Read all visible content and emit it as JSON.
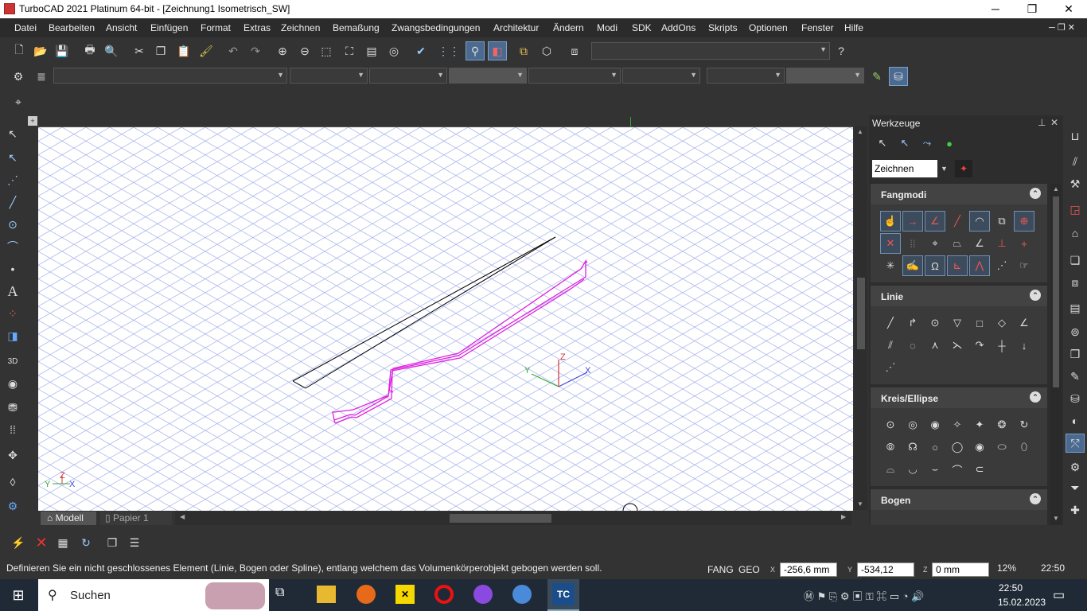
{
  "window": {
    "title": "TurboCAD 2021 Platinum 64-bit - [Zeichnung1 Isometrisch_SW]",
    "minimize": "─",
    "maximize": "❐",
    "close": "✕"
  },
  "menu": [
    "Datei",
    "Bearbeiten",
    "Ansicht",
    "Einfügen",
    "Format",
    "Extras",
    "Zeichnen",
    "Bemaßung",
    "Zwangsbedingungen",
    "Architektur",
    "Ändern",
    "Modi",
    "SDK",
    "AddOns",
    "Skripts",
    "Optionen",
    "Fenster",
    "Hilfe"
  ],
  "panel": {
    "title": "Werkzeuge",
    "palette_select": "Zeichnen",
    "sections": [
      {
        "label": "Fangmodi",
        "rows": 3
      },
      {
        "label": "Linie",
        "rows": 3
      },
      {
        "label": "Kreis/Ellipse",
        "rows": 3
      },
      {
        "label": "Bogen",
        "rows": 0
      }
    ]
  },
  "tabs": {
    "model": "Modell",
    "paper": "Papier 1"
  },
  "status": {
    "message": "Definieren Sie ein nicht geschlossenes Element (Linie, Bogen oder Spline), entlang welchem das Volumenkörperobjekt gebogen werden soll.",
    "fang": "FANG",
    "geo": "GEO",
    "x_value": "-256,6 mm",
    "y_value": "-534,12 mm",
    "z_value": "0 mm",
    "zoom": "12%",
    "time": "22:50"
  },
  "axes": {
    "x": "X",
    "y": "Y",
    "z": "Z"
  },
  "taskbar": {
    "search": "Suchen",
    "time": "22:50",
    "date": "15.02.2023",
    "tc_label": "TC"
  },
  "colors": {
    "profile": "#e020e0",
    "path": "#000000",
    "grid": "#9aa8e6",
    "accent": "#4a6a90"
  }
}
